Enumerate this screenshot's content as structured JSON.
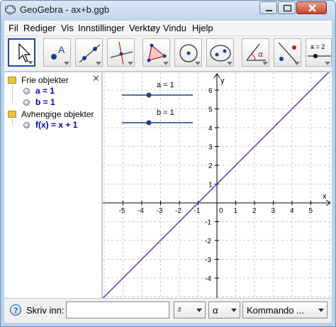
{
  "window": {
    "title": "GeoGebra - ax+b.ggb"
  },
  "menu": [
    "Fil",
    "Rediger",
    "Vis",
    "Innstillinger",
    "Verktøy",
    "Vindu",
    "Hjelp"
  ],
  "toolbar": {
    "tools": [
      {
        "icon": "move-arrow-icon",
        "selected": true
      },
      {
        "icon": "new-point-icon"
      },
      {
        "icon": "line-through-two-points-icon"
      },
      {
        "icon": "perpendicular-line-icon"
      },
      {
        "icon": "polygon-icon"
      },
      {
        "icon": "circle-center-point-icon"
      },
      {
        "icon": "ellipse-icon"
      },
      {
        "icon": "angle-icon"
      },
      {
        "icon": "reflect-about-line-icon"
      },
      {
        "icon": "slider-icon"
      }
    ],
    "angle_symbol": "α",
    "slider_tool_text": "a = 2"
  },
  "algebra": {
    "free_label": "Frie objekter",
    "dependent_label": "Avhengige objekter",
    "free_items": [
      "a = 1",
      "b = 1"
    ],
    "dependent_items": [
      "f(x) = x + 1"
    ],
    "close_symbol": "✕"
  },
  "graphics": {
    "x_ticks": [
      "-5",
      "-4",
      "-3",
      "-2",
      "-1",
      "0",
      "1",
      "2",
      "3",
      "4",
      "5"
    ],
    "y_ticks": [
      "6",
      "5",
      "4",
      "3",
      "2",
      "1",
      "-1",
      "-2",
      "-3",
      "-4"
    ],
    "x_axis_label": "x",
    "y_axis_label": "y",
    "slider_a": {
      "label": "a = 1",
      "value": 1
    },
    "slider_b": {
      "label": "b = 1",
      "value": 1
    },
    "function": {
      "a": 1,
      "b": 1,
      "color": "#3a3ad0"
    }
  },
  "inputbar": {
    "label": "Skriv inn:",
    "input_value": "",
    "help_symbol": "?",
    "superscript_combo": "²",
    "greek_combo": "α",
    "command_combo": "Kommando ..."
  },
  "colors": {
    "accent": "#1e4aa8",
    "object_text": "#0000cc",
    "folder": "#f0c23d"
  }
}
